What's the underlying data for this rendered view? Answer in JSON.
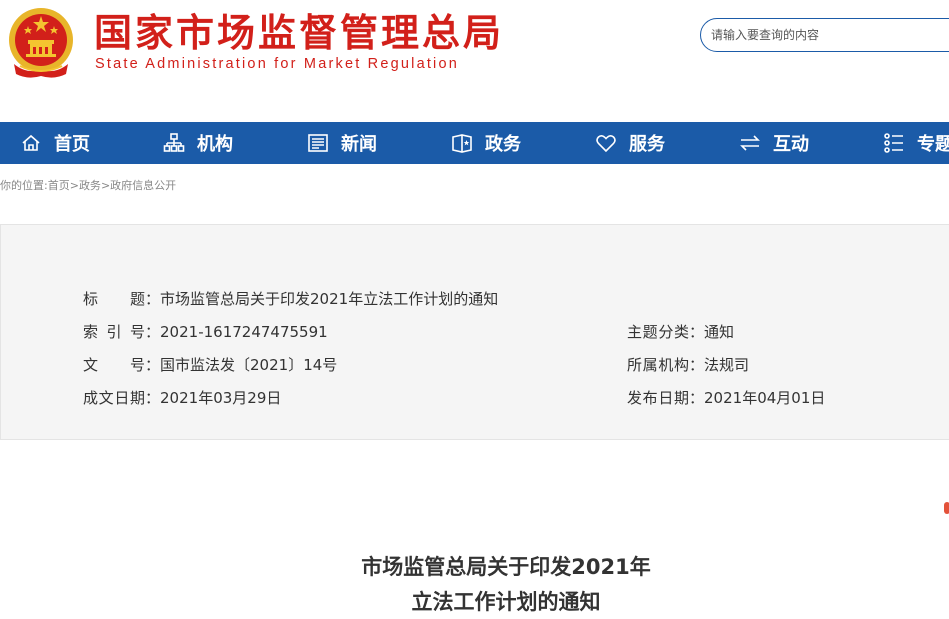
{
  "header": {
    "title_cn": "国家市场监督管理总局",
    "title_en": "State Administration for Market Regulation",
    "emblem_icon": "national-emblem-icon",
    "search_placeholder": "请输入要查询的内容"
  },
  "nav": {
    "items": [
      {
        "label": "首页",
        "icon": "home-icon"
      },
      {
        "label": "机构",
        "icon": "organization-icon"
      },
      {
        "label": "新闻",
        "icon": "news-icon"
      },
      {
        "label": "政务",
        "icon": "government-affairs-icon"
      },
      {
        "label": "服务",
        "icon": "heart-icon"
      },
      {
        "label": "互动",
        "icon": "exchange-arrows-icon"
      },
      {
        "label": "专题",
        "icon": "topics-icon"
      }
    ]
  },
  "breadcrumb": {
    "prefix": "你的位置:",
    "items": [
      "首页",
      "政务",
      "政府信息公开"
    ],
    "separator": ">"
  },
  "meta": {
    "title_label": "标　题",
    "title_value": "市场监管总局关于印发2021年立法工作计划的通知",
    "index_label": "索 引 号",
    "index_value": "2021-1617247475591",
    "doc_no_label": "文　号",
    "doc_no_value": "国市监法发〔2021〕14号",
    "created_label": "成文日期",
    "created_value": "2021年03月29日",
    "category_label": "主题分类",
    "category_value": "通知",
    "org_label": "所属机构",
    "org_value": "法规司",
    "published_label": "发布日期",
    "published_value": "2021年04月01日",
    "colon": "："
  },
  "article": {
    "title_line1": "市场监管总局关于印发2021年",
    "title_line2": "立法工作计划的通知"
  },
  "colors": {
    "brand_red": "#d2201a",
    "nav_blue": "#1b5ba8",
    "panel_bg": "#f5f5f5"
  }
}
